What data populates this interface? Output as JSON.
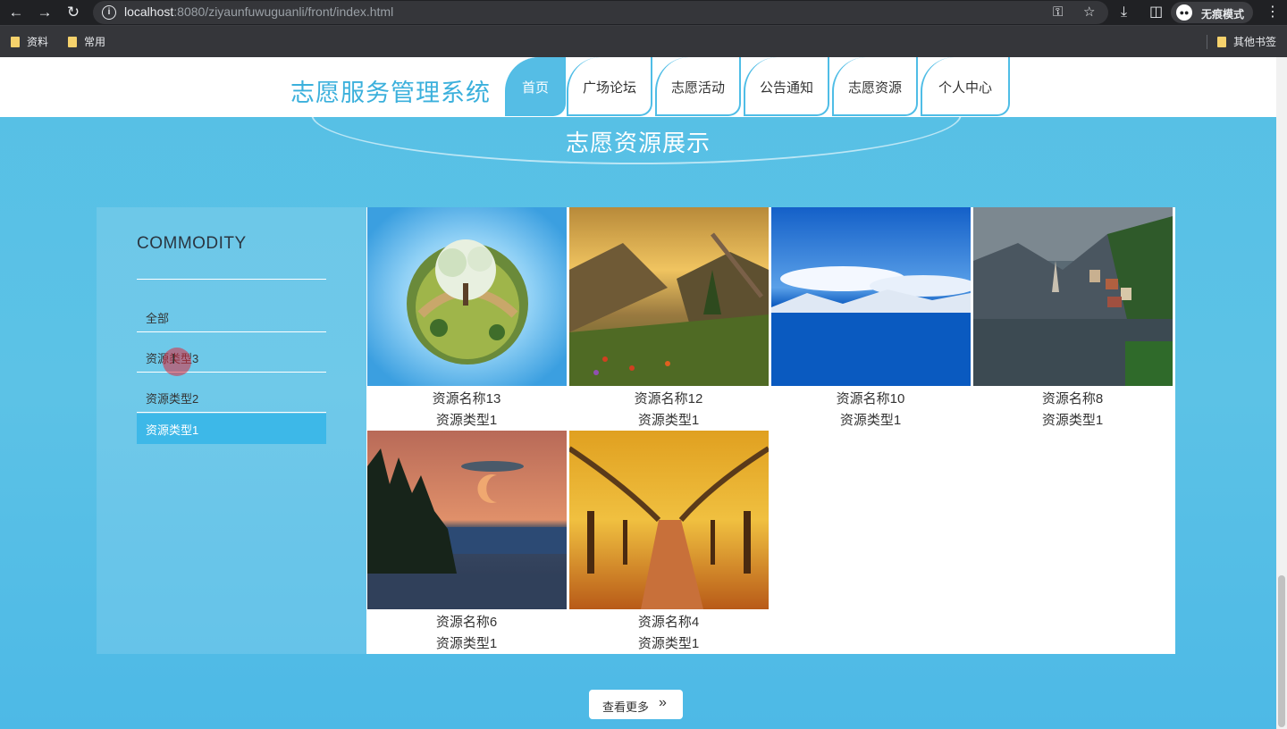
{
  "browser": {
    "url_host": "localhost",
    "url_rest": ":8080/ziyaunfuwuguanli/front/index.html",
    "incognito_label": "无痕模式",
    "bookmarks": [
      "资料",
      "常用"
    ],
    "other_bookmarks": "其他书签"
  },
  "header": {
    "logo": "志愿服务管理系统",
    "nav": [
      "首页",
      "广场论坛",
      "志愿活动",
      "公告通知",
      "志愿资源",
      "个人中心"
    ],
    "active_index": 0
  },
  "section": {
    "title": "志愿资源展示"
  },
  "sidebar": {
    "title": "COMMODITY",
    "categories": [
      "全部",
      "资源类型3",
      "资源类型2",
      "资源类型1"
    ],
    "active_index": 3
  },
  "items": [
    {
      "name": "资源名称13",
      "type": "资源类型1",
      "image": "tiny-planet-tree"
    },
    {
      "name": "资源名称12",
      "type": "资源类型1",
      "image": "mountain-valley-sunset"
    },
    {
      "name": "资源名称10",
      "type": "资源类型1",
      "image": "blue-lake-snow-mountains"
    },
    {
      "name": "资源名称8",
      "type": "资源类型1",
      "image": "hallstatt-lake-village"
    },
    {
      "name": "资源名称6",
      "type": "资源类型1",
      "image": "moon-over-lake-pines"
    },
    {
      "name": "资源名称4",
      "type": "资源类型1",
      "image": "autumn-tree-tunnel"
    }
  ],
  "more_button": {
    "label": "查看更多",
    "icon": "double-chevron-right-icon"
  },
  "colors": {
    "accent": "#3bb0dc",
    "page_bg": "#56c0e5",
    "active_cat": "#3db8e8"
  }
}
